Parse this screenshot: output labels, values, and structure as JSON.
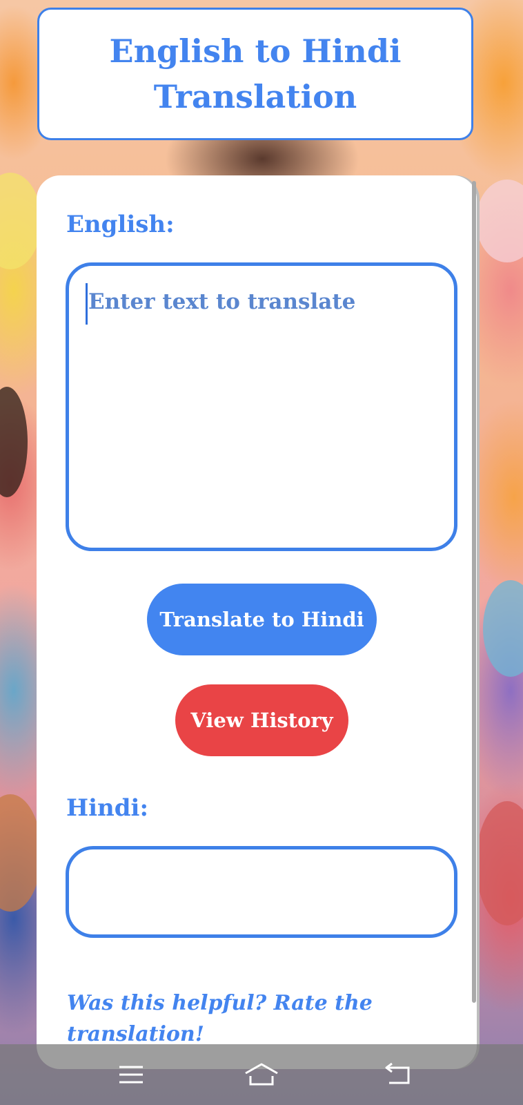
{
  "header": {
    "title": "English to Hindi Translation"
  },
  "english_section": {
    "label": "English:",
    "input_value": "",
    "input_placeholder": "Enter text to translate"
  },
  "actions": {
    "translate_label": "Translate to Hindi",
    "history_label": "View History"
  },
  "hindi_section": {
    "label": "Hindi:",
    "output_value": ""
  },
  "feedback": {
    "prompt": "Was this helpful? Rate the translation!"
  },
  "system_nav": {
    "recents_icon": "recents-icon",
    "home_icon": "home-icon",
    "back_icon": "back-icon"
  },
  "colors": {
    "accent_blue": "#4285f0",
    "danger_red": "#e94446",
    "border_blue": "#3e80e8"
  }
}
